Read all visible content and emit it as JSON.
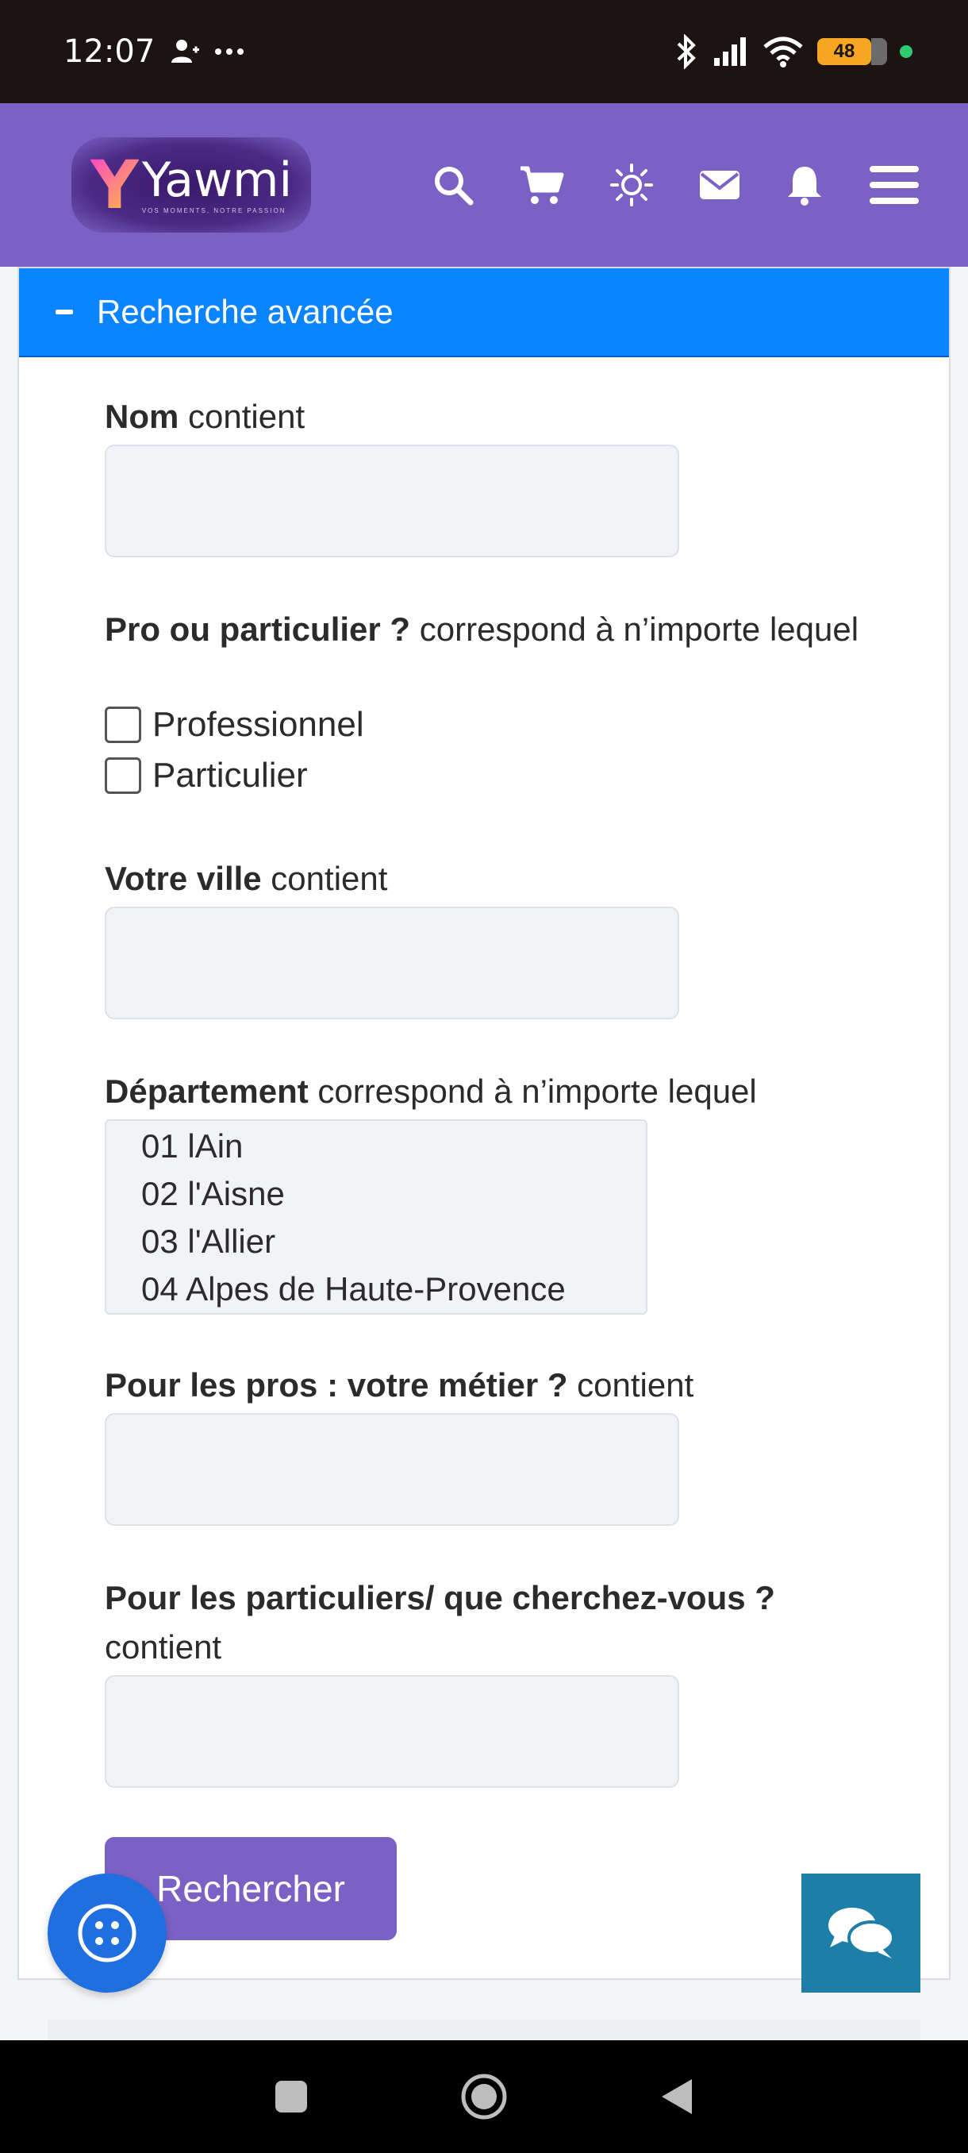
{
  "status_bar": {
    "time": "12:07",
    "battery": "48"
  },
  "header": {
    "logo_text": "Yawmi",
    "logo_tagline": "VOS MOMENTS, NOTRE PASSION",
    "icons": [
      "search-icon",
      "cart-icon",
      "sun-icon",
      "mail-icon",
      "bell-icon",
      "menu-icon"
    ]
  },
  "panel": {
    "title": "Recherche avancée"
  },
  "form": {
    "nom": {
      "label_bold": "Nom",
      "label_rest": " contient",
      "value": ""
    },
    "pro": {
      "label_bold": "Pro ou particulier ?",
      "label_rest": " correspond à n’importe lequel",
      "options": [
        "Professionnel",
        "Particulier"
      ]
    },
    "ville": {
      "label_bold": "Votre ville",
      "label_rest": " contient",
      "value": ""
    },
    "departement": {
      "label_bold": "Département",
      "label_rest": " correspond à n’importe lequel",
      "options": [
        "01 lAin",
        "02 l'Aisne",
        "03 l'Allier",
        "04 Alpes de Haute-Provence"
      ]
    },
    "metier": {
      "label_bold": "Pour les pros : votre métier ?",
      "label_rest": " contient",
      "value": ""
    },
    "cherchez": {
      "label_bold": "Pour les particuliers/ que cherchez-vous ?",
      "label_rest": " contient",
      "value": ""
    },
    "submit_label": "Rechercher"
  },
  "colors": {
    "header_bg": "#7b61c4",
    "panel_header_bg": "#0a84ff",
    "button_bg": "#7b61c4",
    "chat_bg": "#1d7ea8",
    "accessibility_bg": "#1f6fe0"
  }
}
